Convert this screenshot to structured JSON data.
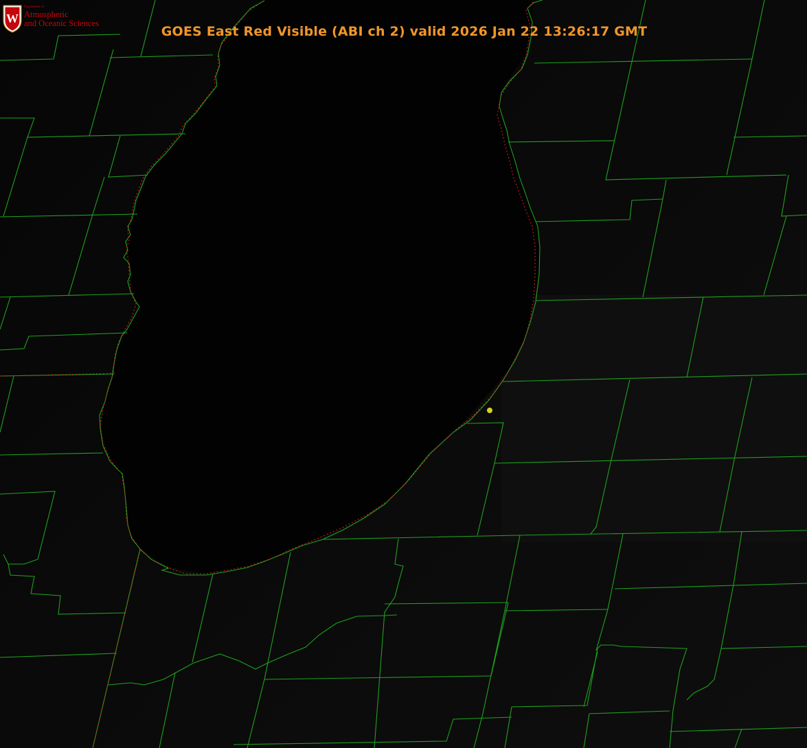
{
  "title": "GOES East Red Visible (ABI ch 2) valid 2026 Jan 22 13:26:17 GMT",
  "logo": {
    "department": "Department of",
    "line1": "Atmospheric",
    "line2": "and Oceanic Sciences",
    "crest_letter": "W",
    "brand_color": "#c5050c"
  },
  "colors": {
    "background": "#000000",
    "county_lines": "#1fa21f",
    "shoreline_dotted": "#e02020",
    "title": "#f0962a",
    "marker": "#d6d21e"
  },
  "icons": [
    "uw-crest-icon",
    "location-marker-icon"
  ]
}
